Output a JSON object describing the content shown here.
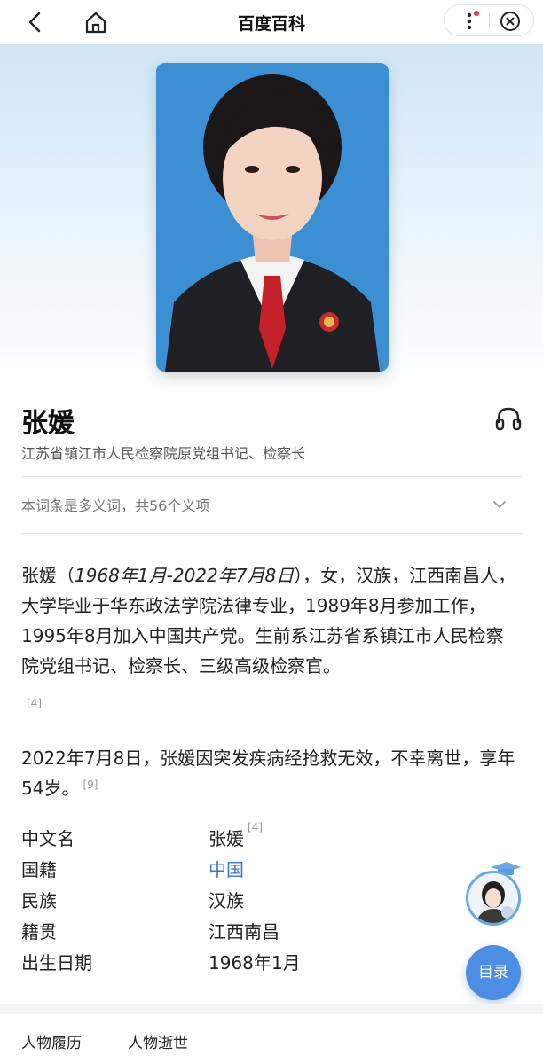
{
  "header": {
    "title": "百度百科",
    "icons": [
      "back-icon",
      "home-icon",
      "more-icon",
      "close-icon"
    ],
    "notification_dot_color": "#e33333"
  },
  "entry": {
    "name": "张媛",
    "subtitle": "江苏省镇江市人民检察院原党组书记、检察长",
    "polysemy_text": "本词条是多义词，共56个义项"
  },
  "summary": {
    "p1_prefix": "张媛（",
    "p1_dates": "1968年1月-2022年7月8日",
    "p1_rest": "），女，汉族，江西南昌人，大学毕业于华东政法学院法律专业，1989年8月参加工作，1995年8月加入中国共产党。生前系江苏省系镇江市人民检察院党组书记、检察长、三级高级检察官。",
    "p1_cite": "[4]",
    "p2_text": "2022年7月8日，张媛因突发疾病经抢救无效，不幸离世，享年54岁。",
    "p2_cite": "[9]"
  },
  "basic_info": [
    {
      "key": "中文名",
      "value": "张媛",
      "cite": "[4]"
    },
    {
      "key": "国籍",
      "value": "中国"
    },
    {
      "key": "民族",
      "value": "汉族"
    },
    {
      "key": "籍贯",
      "value": "江西南昌"
    },
    {
      "key": "出生日期",
      "value": "1968年1月"
    }
  ],
  "floating": {
    "toc_label": "目录"
  },
  "bottom_tabs": [
    "人物履历",
    "人物逝世"
  ],
  "colors": {
    "link": "#3a76c0",
    "accent": "#4d8de4",
    "portrait_bg": "#3d8fd4"
  }
}
